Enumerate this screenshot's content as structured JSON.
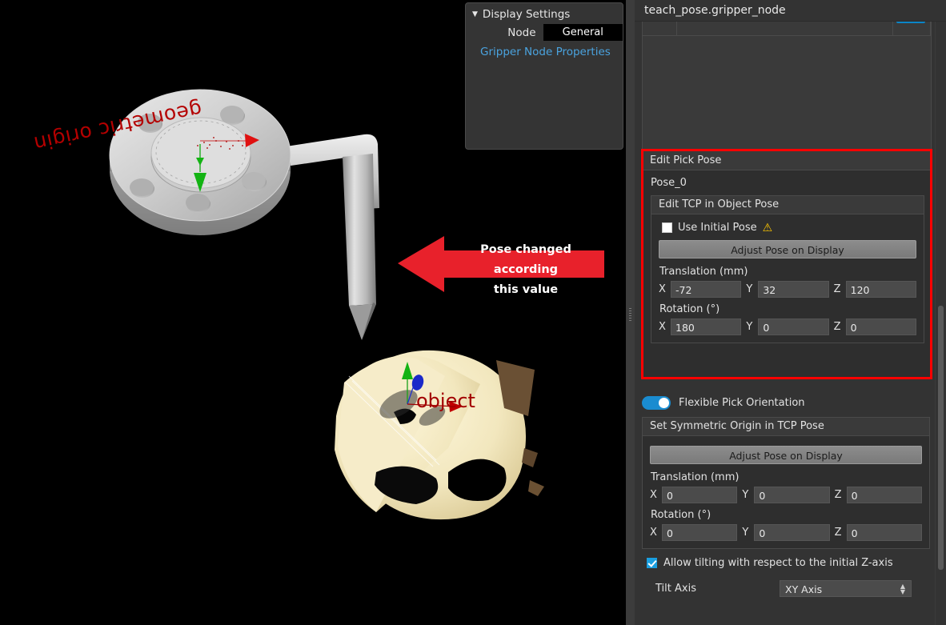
{
  "viewport": {
    "background_color": "#000000",
    "labels": {
      "geometric_origin": "geometric origin",
      "object": "object"
    },
    "annotation": {
      "line1": "Pose changed according",
      "line2": "this value",
      "color": "#e8212b"
    }
  },
  "display_settings": {
    "title": "Display Settings",
    "caret": "▼",
    "node_label": "Node",
    "node_value": "General",
    "link": "Gripper Node Properties",
    "link_color": "#4aa3df"
  },
  "right_panel": {
    "header_title": "teach_pose.gripper_node",
    "edit_pick_pose": {
      "group_title": "Edit Pick Pose",
      "pose_name": "Pose_0",
      "highlight_color": "#ff0000",
      "tcp_group": {
        "title": "Edit TCP in Object Pose",
        "use_initial_pose_label": "Use Initial Pose",
        "use_initial_pose_checked": false,
        "warning_icon": "⚠",
        "warning_color": "#ffc800",
        "adjust_button": "Adjust Pose on Display",
        "translation_label": "Translation (mm)",
        "translation": {
          "x_axis": "X",
          "y_axis": "Y",
          "z_axis": "Z",
          "x": "-72",
          "y": "32",
          "z": "120"
        },
        "rotation_label": "Rotation (°)",
        "rotation": {
          "x_axis": "X",
          "y_axis": "Y",
          "z_axis": "Z",
          "x": "180",
          "y": "0",
          "z": "0"
        }
      }
    },
    "flexible_pick": {
      "toggle_label": "Flexible Pick Orientation",
      "toggle_on": true,
      "toggle_color": "#1a8cd0",
      "symmetric_group": {
        "title": "Set Symmetric Origin in TCP Pose",
        "adjust_button": "Adjust Pose on Display",
        "translation_label": "Translation (mm)",
        "translation": {
          "x_axis": "X",
          "y_axis": "Y",
          "z_axis": "Z",
          "x": "0",
          "y": "0",
          "z": "0"
        },
        "rotation_label": "Rotation (°)",
        "rotation": {
          "x_axis": "X",
          "y_axis": "Y",
          "z_axis": "Z",
          "x": "0",
          "y": "0",
          "z": "0"
        }
      },
      "allow_tilt_label": "Allow tilting with respect to the initial Z-axis",
      "allow_tilt_checked": true,
      "tilt_axis_label": "Tilt Axis",
      "tilt_axis_value": "XY Axis"
    }
  }
}
